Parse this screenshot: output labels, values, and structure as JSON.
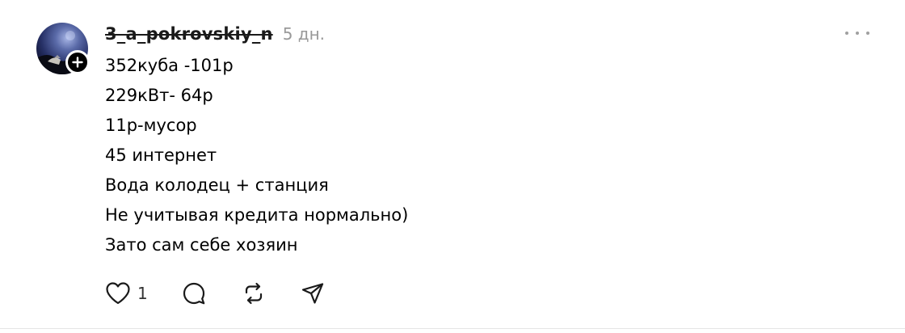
{
  "post": {
    "username": "3_a_pokrovskiy_n",
    "timestamp": "5 дн.",
    "lines": [
      "352куба -101р",
      "229кВт- 64р",
      "11р-мусор",
      "45 интернет",
      "Вода колодец + станция",
      "Не учитывая кредита нормально)",
      "Зато сам себе хозяин"
    ],
    "like_count": "1"
  },
  "icons": {
    "more": "more-horizontal-icon",
    "follow": "plus-icon",
    "like": "heart-icon",
    "reply": "comment-icon",
    "repost": "repost-icon",
    "share": "send-icon"
  },
  "colors": {
    "text": "#000000",
    "muted": "#999999",
    "icon": "#1a1a1a",
    "divider": "#e5e5e5"
  }
}
